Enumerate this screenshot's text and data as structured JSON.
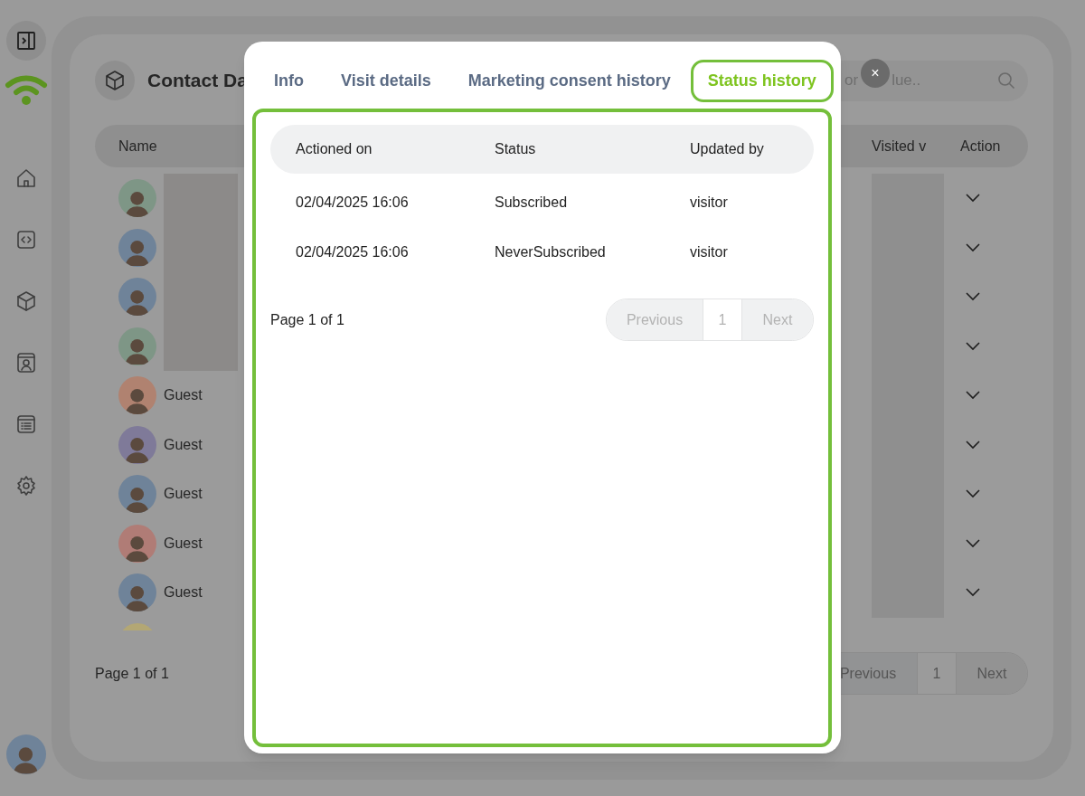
{
  "sidebar": {
    "items": [
      {
        "kind": "home",
        "selected": false
      },
      {
        "kind": "code",
        "selected": false
      },
      {
        "kind": "cube",
        "selected": false
      },
      {
        "kind": "contact",
        "selected": false
      },
      {
        "kind": "list",
        "selected": false
      },
      {
        "kind": "settings",
        "selected": false
      }
    ]
  },
  "page": {
    "title": "Contact Da",
    "search": {
      "visible_text": [
        "or",
        "lue.."
      ]
    },
    "table": {
      "columns": [
        "Name",
        "Visited v",
        "Action"
      ],
      "rows": [
        {
          "color": "#7e9686",
          "name_redacted": true,
          "visited_redacted": true
        },
        {
          "color": "#6f8399",
          "name_redacted": true,
          "visited_redacted": true
        },
        {
          "color": "#6f8399",
          "name_redacted": true,
          "visited_redacted": true
        },
        {
          "color": "#7e9686",
          "name_redacted": true,
          "visited_redacted": true
        },
        {
          "color": "#b08270",
          "name": "Guest",
          "name_redacted": false,
          "visited_redacted": true
        },
        {
          "color": "#7f7a99",
          "name": "Guest",
          "name_redacted": false,
          "visited_redacted": true
        },
        {
          "color": "#6f8399",
          "name": "Guest",
          "name_redacted": false,
          "visited_redacted": true
        },
        {
          "color": "#b07c76",
          "name": "Guest",
          "name_redacted": false,
          "visited_redacted": true
        },
        {
          "color": "#6f8399",
          "name": "Guest",
          "name_redacted": false,
          "visited_redacted": true
        },
        {
          "color": "#b3a774"
        }
      ]
    },
    "pagination": {
      "summary": "Page 1 of 1",
      "buttons": [
        "Previous",
        "1",
        "Next"
      ]
    }
  },
  "user": {
    "color": "#6f8399"
  },
  "dialog": {
    "close": "×",
    "tabs": [
      {
        "label": "Info",
        "selected": false
      },
      {
        "label": "Visit details",
        "selected": false
      },
      {
        "label": "Marketing consent history",
        "selected": false
      },
      {
        "label": "Status history",
        "selected": true
      }
    ],
    "table": {
      "columns": [
        "Actioned on",
        "Status",
        "Updated by"
      ],
      "rows": [
        [
          "02/04/2025 16:06",
          "Subscribed",
          "visitor"
        ],
        [
          "02/04/2025 16:06",
          "NeverSubscribed",
          "visitor"
        ]
      ]
    },
    "pagination": {
      "summary": "Page 1 of 1",
      "buttons": [
        "Previous",
        "1",
        "Next"
      ]
    }
  }
}
